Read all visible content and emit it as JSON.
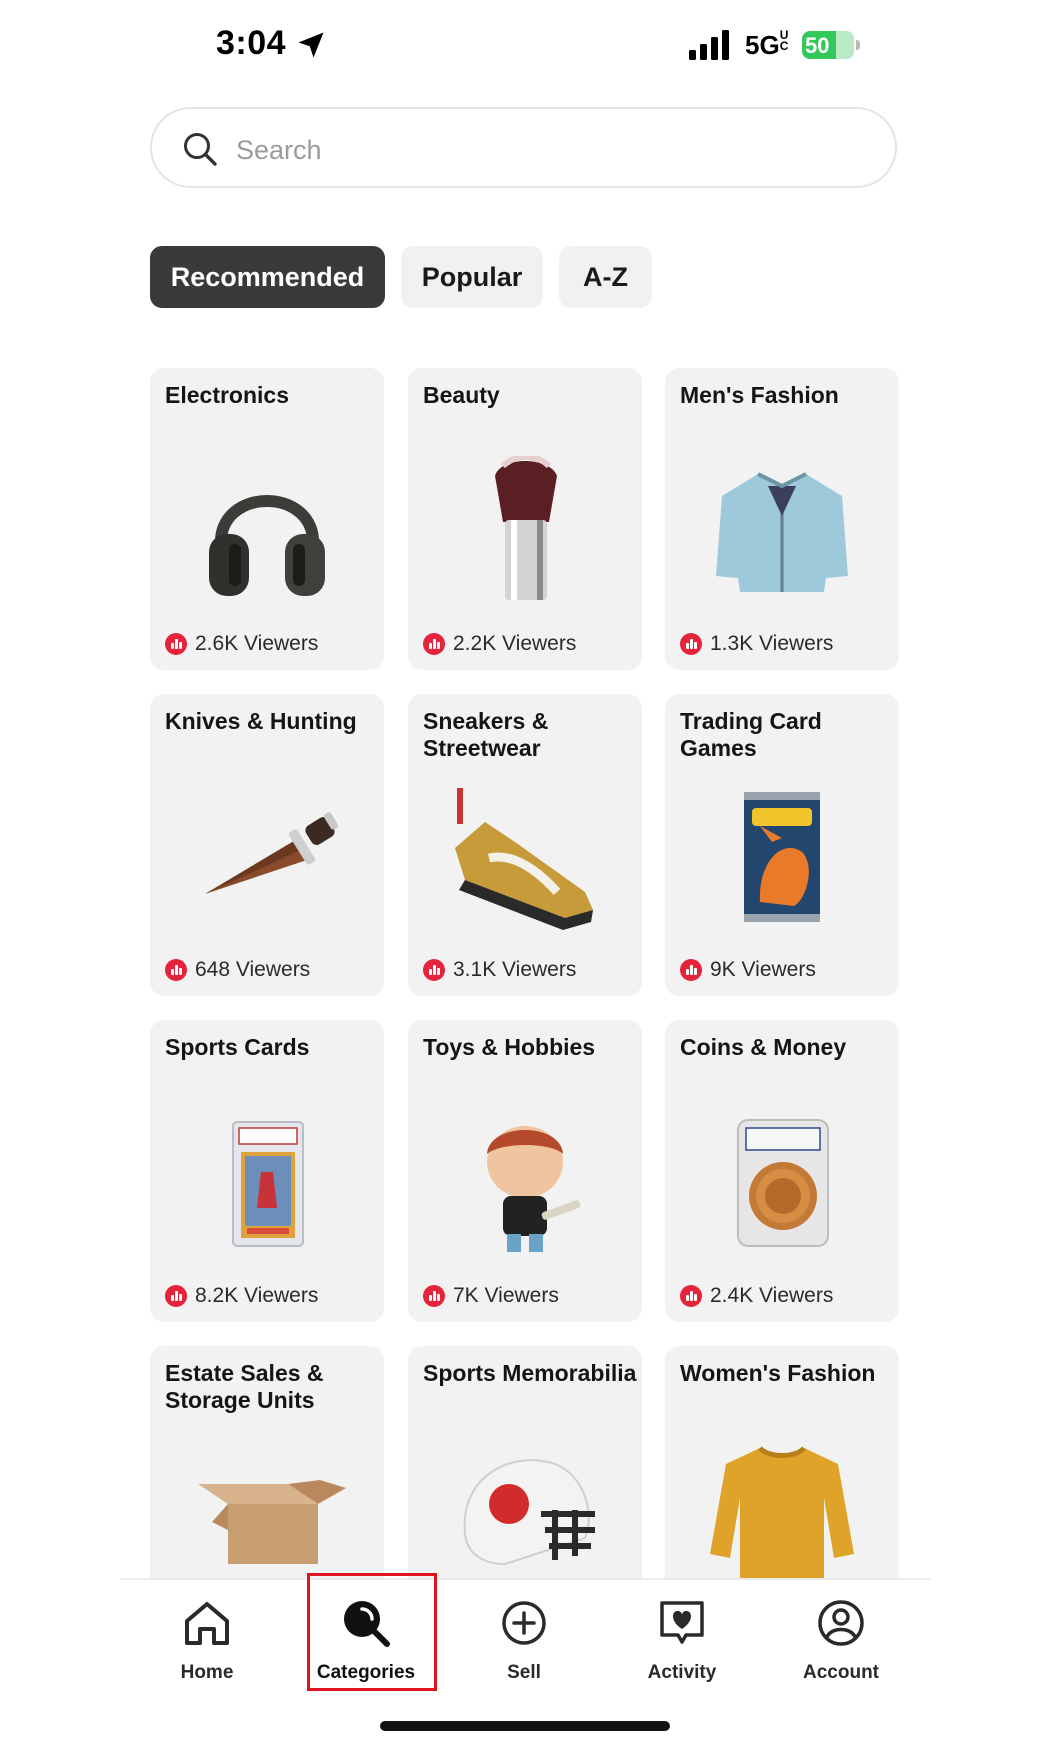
{
  "status_bar": {
    "time": "3:04",
    "network": "5G",
    "network_suffix": "UC",
    "battery": "50"
  },
  "search": {
    "placeholder": "Search",
    "value": ""
  },
  "tabs": [
    {
      "label": "Recommended",
      "active": true
    },
    {
      "label": "Popular",
      "active": false
    },
    {
      "label": "A-Z",
      "active": false
    }
  ],
  "categories": [
    {
      "name": "Electronics",
      "viewers": "2.6K Viewers"
    },
    {
      "name": "Beauty",
      "viewers": "2.2K Viewers"
    },
    {
      "name": "Men's Fashion",
      "viewers": "1.3K Viewers"
    },
    {
      "name": "Knives & Hunting",
      "viewers": "648 Viewers"
    },
    {
      "name": "Sneakers & Streetwear",
      "viewers": "3.1K Viewers"
    },
    {
      "name": "Trading Card Games",
      "viewers": "9K Viewers"
    },
    {
      "name": "Sports Cards",
      "viewers": "8.2K Viewers"
    },
    {
      "name": "Toys & Hobbies",
      "viewers": "7K Viewers"
    },
    {
      "name": "Coins & Money",
      "viewers": "2.4K Viewers"
    },
    {
      "name": "Estate Sales & Storage Units",
      "viewers": ""
    },
    {
      "name": "Sports Memorabilia",
      "viewers": ""
    },
    {
      "name": "Women's Fashion",
      "viewers": ""
    }
  ],
  "nav": {
    "items": [
      {
        "label": "Home"
      },
      {
        "label": "Categories"
      },
      {
        "label": "Sell"
      },
      {
        "label": "Activity"
      },
      {
        "label": "Account"
      }
    ],
    "active": "Categories"
  },
  "colors": {
    "accent_live": "#e5243b",
    "tab_active": "#3a3a3a",
    "card_bg": "#f2f2f2",
    "highlight": "#e0141f"
  }
}
